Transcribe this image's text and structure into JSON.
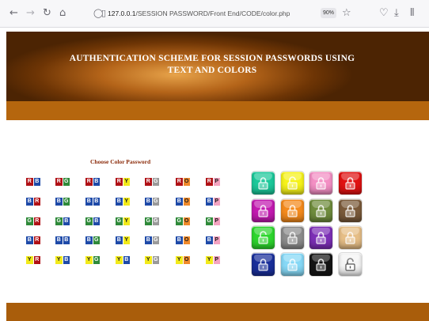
{
  "browser": {
    "url_host": "127.0.0.1",
    "url_path": "/SESSION PASSWORD/Front End/CODE/color.php",
    "zoom": "90%"
  },
  "header": {
    "title_line1": "AUTHENTICATION SCHEME FOR SESSION PASSWORDS USING",
    "title_line2": "TEXT AND COLORS"
  },
  "grid": {
    "title": "Choose Color Password",
    "rows": [
      [
        "RB",
        "RG",
        "RB",
        "RY",
        "RG",
        "RO",
        "RP"
      ],
      [
        "BR",
        "BG",
        "BB",
        "BY",
        "BG",
        "BO",
        "BP"
      ],
      [
        "GR",
        "GB",
        "GB",
        "GY",
        "GG",
        "GO",
        "GP"
      ],
      [
        "BR",
        "BB",
        "BG",
        "BY",
        "BG",
        "BO",
        "BP"
      ],
      [
        "YR",
        "YB",
        "YG",
        "YB",
        "YG",
        "YO",
        "YP"
      ]
    ]
  },
  "letter_colors": {
    "R": "#b01116",
    "B": "#1e4aa8",
    "G": "#2f8a3a",
    "Y": "#f2ea1a",
    "O": "#f08a2a",
    "P": "#f4a3c1",
    "K": "#151515",
    "A": "#9a9a9a"
  },
  "locks": {
    "colors": [
      [
        "#1cc89a",
        "#f5f21a",
        "#f38fc4",
        "#e01212"
      ],
      [
        "#c21ab0",
        "#f48a1c",
        "#6f8c3d",
        "#7a5a3a"
      ],
      [
        "#2ed62e",
        "#8c8c8c",
        "#7c2fb6",
        "#e6be86"
      ],
      [
        "#1a2f9a",
        "#86d8f6",
        "#151515",
        "#f4f4f4"
      ]
    ],
    "open": [
      [
        false,
        true,
        false,
        false
      ],
      [
        false,
        false,
        false,
        false
      ],
      [
        true,
        false,
        false,
        false
      ],
      [
        false,
        false,
        false,
        true
      ]
    ]
  }
}
